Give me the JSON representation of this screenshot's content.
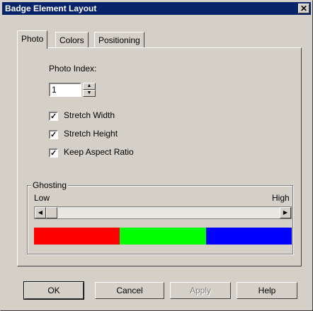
{
  "window": {
    "title": "Badge Element Layout",
    "close_glyph": "✕"
  },
  "tabs": [
    {
      "label": "Photo",
      "active": true
    },
    {
      "label": "Colors",
      "active": false
    },
    {
      "label": "Positioning",
      "active": false
    }
  ],
  "photo": {
    "index_label": "Photo Index:",
    "index_value": "1",
    "options": [
      {
        "label": "Stretch Width",
        "checked": true
      },
      {
        "label": "Stretch Height",
        "checked": true
      },
      {
        "label": "Keep Aspect Ratio",
        "checked": true
      }
    ]
  },
  "ghosting": {
    "legend": "Ghosting",
    "low_label": "Low",
    "high_label": "High",
    "slider_level": 0,
    "colors": [
      "#ff0000",
      "#00ff00",
      "#0000ff"
    ]
  },
  "buttons": {
    "ok": "OK",
    "cancel": "Cancel",
    "apply": "Apply",
    "help": "Help"
  },
  "icons": {
    "close": "close-icon",
    "spin_up": "arrow-up-icon",
    "spin_down": "arrow-down-icon",
    "scroll_left": "arrow-left-icon",
    "scroll_right": "arrow-right-icon",
    "checkmark": "checkmark-icon"
  }
}
